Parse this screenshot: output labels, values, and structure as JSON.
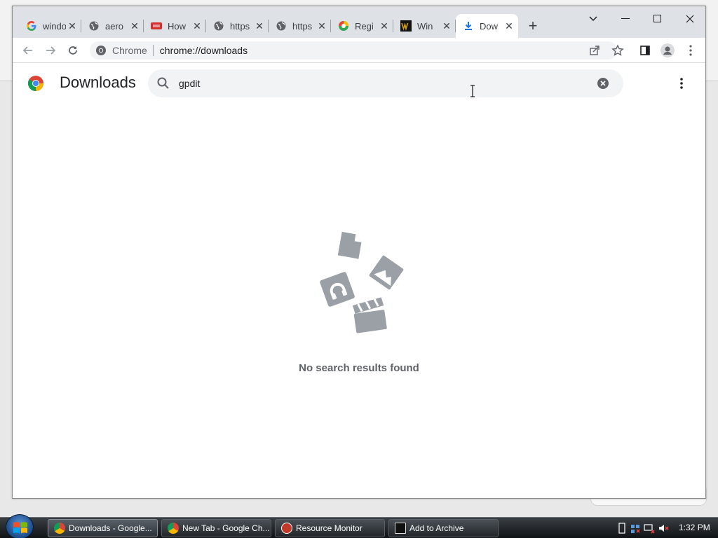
{
  "browser": {
    "tabs": [
      {
        "title": "windo",
        "favicon": "google-icon"
      },
      {
        "title": "aero",
        "favicon": "globe-icon"
      },
      {
        "title": "How",
        "favicon": "site-icon"
      },
      {
        "title": "https",
        "favicon": "globe-icon"
      },
      {
        "title": "https",
        "favicon": "globe-icon"
      },
      {
        "title": "Regi",
        "favicon": "edge-icon"
      },
      {
        "title": "Win",
        "favicon": "w-icon"
      },
      {
        "title": "Dow",
        "favicon": "download-icon"
      }
    ],
    "site_label": "Chrome",
    "url": "chrome://downloads"
  },
  "downloads": {
    "title": "Downloads",
    "search_value": "gpdit",
    "empty_message": "No search results found"
  },
  "taskbar": {
    "items": [
      {
        "label": "Downloads - Google...",
        "icon": "chrome-icon"
      },
      {
        "label": "New Tab - Google Ch...",
        "icon": "chrome-icon"
      },
      {
        "label": "Resource Monitor",
        "icon": "resource-monitor-icon"
      },
      {
        "label": "Add to Archive",
        "icon": "7zip-icon"
      }
    ],
    "clock": "1:32 PM"
  },
  "colors": {
    "tabstrip": "#dee1e6",
    "accent_blue": "#1a73e8",
    "empty_art": "#9aa0a6"
  }
}
